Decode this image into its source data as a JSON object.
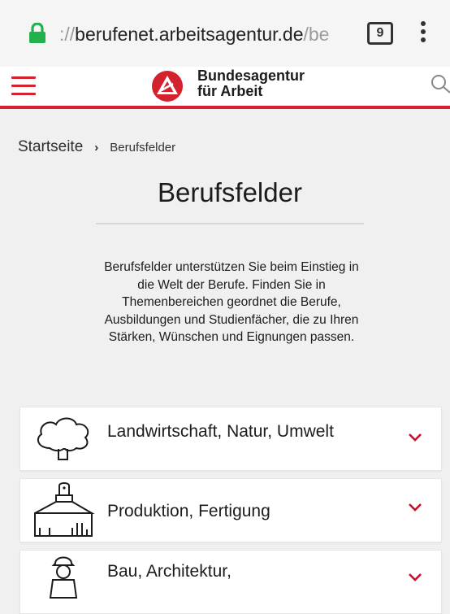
{
  "browser": {
    "url_prefix": "://",
    "url_host": "berufenet.arbeitsagentur.de",
    "url_path": "/be",
    "tab_count": "9",
    "icons": {
      "lock": "lock-icon",
      "menu": "kebab-menu-icon"
    },
    "colors": {
      "lock": "#22b14c"
    }
  },
  "header": {
    "logo_line1": "Bundesagentur",
    "logo_line2": "für Arbeit",
    "icons": {
      "menu": "hamburger-icon",
      "logo": "ba-logo-icon",
      "search": "search-icon"
    },
    "colors": {
      "accent": "#d4212e"
    }
  },
  "breadcrumb": {
    "home": "Startseite",
    "separator": "›",
    "current": "Berufsfelder"
  },
  "page": {
    "title": "Berufsfelder",
    "intro": "Berufsfelder unterstützen Sie beim Einstieg in die Welt der Berufe. Finden Sie in Themenbereichen geordnet die Berufe, Ausbildungen und Studienfächer, die zu Ihren Stärken, Wünschen und Eignungen passen."
  },
  "fields": [
    {
      "label": "Landwirtschaft, Natur, Umwelt",
      "icon": "tree-icon"
    },
    {
      "label": "Produktion, Fertigung",
      "icon": "brush-icon"
    },
    {
      "label": "Bau, Architektur,",
      "icon": "construction-worker-icon"
    }
  ]
}
